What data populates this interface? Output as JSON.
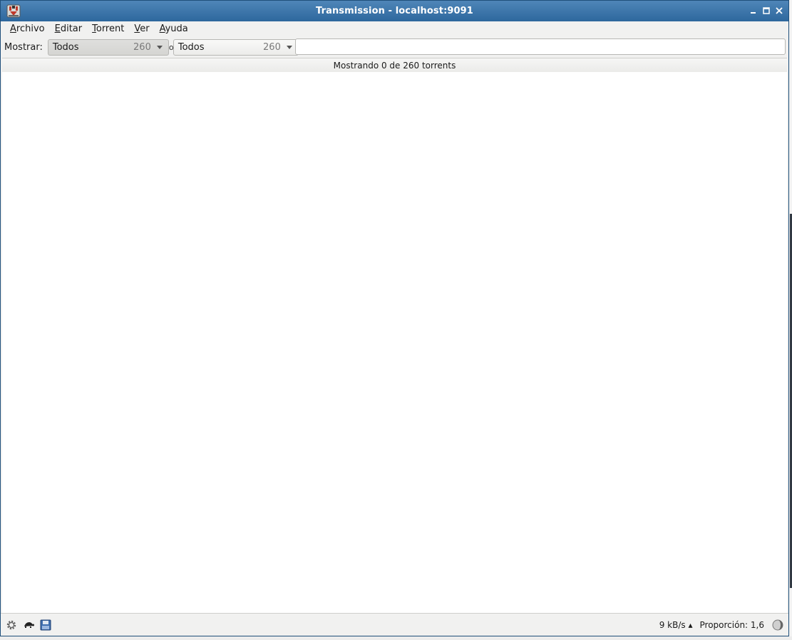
{
  "window": {
    "title": "Transmission - localhost:9091",
    "app_icon": "transmission-icon",
    "controls": [
      "minimize-icon",
      "maximize-icon",
      "close-icon"
    ]
  },
  "menubar": {
    "items": [
      {
        "label": "Archivo",
        "accel": "A",
        "rest": "rchivo"
      },
      {
        "label": "Editar",
        "accel": "E",
        "rest": "ditar"
      },
      {
        "label": "Torrent",
        "accel": "T",
        "rest": "orrent"
      },
      {
        "label": "Ver",
        "accel": "V",
        "rest": "er"
      },
      {
        "label": "Ayuda",
        "accel": "A",
        "rest": "yuda"
      }
    ]
  },
  "filterbar": {
    "label": "Mostrar:",
    "status_filter": {
      "value": "Todos",
      "count": "260"
    },
    "separator_text": "o",
    "tracker_filter": {
      "value": "Todos",
      "count": "260"
    },
    "search_value": ""
  },
  "list": {
    "header": "Mostrando 0 de 260 torrents",
    "rows": []
  },
  "statusbar": {
    "icons": [
      "gear-icon",
      "turtle-icon",
      "disk-icon"
    ],
    "speed": "9 kB/s ▴",
    "ratio": "Proporción: 1,6",
    "ratio_icon": "ratio-icon"
  },
  "colors": {
    "titlebar": "#2d679d",
    "window_bg": "#f1f1f0",
    "list_bg": "#ffffff"
  }
}
